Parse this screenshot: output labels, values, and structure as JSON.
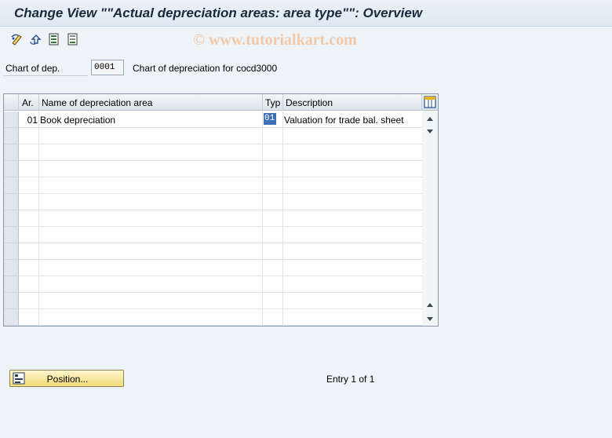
{
  "window": {
    "title": "Change View \"\"Actual depreciation areas: area type\"\": Overview"
  },
  "toolbar": {
    "icons": [
      "display-change-icon",
      "undo-icon",
      "select-all-icon",
      "deselect-all-icon"
    ]
  },
  "watermark": "© www.tutorialkart.com",
  "header": {
    "label": "Chart of dep.",
    "value": "0001",
    "description": "Chart of depreciation for cocd3000"
  },
  "table": {
    "columns": {
      "ar": "Ar.",
      "name": "Name of depreciation area",
      "typ": "Typ",
      "desc": "Description"
    },
    "rows": [
      {
        "ar": "01",
        "name": "Book depreciation",
        "typ": "01",
        "desc": "Valuation for trade bal. sheet"
      }
    ],
    "empty_rows": 12
  },
  "footer": {
    "position_button": "Position...",
    "entry_text": "Entry 1 of 1"
  },
  "colors": {
    "accent": "#3e6fb5",
    "button": "#f1db7a",
    "background": "#eef3f8"
  }
}
